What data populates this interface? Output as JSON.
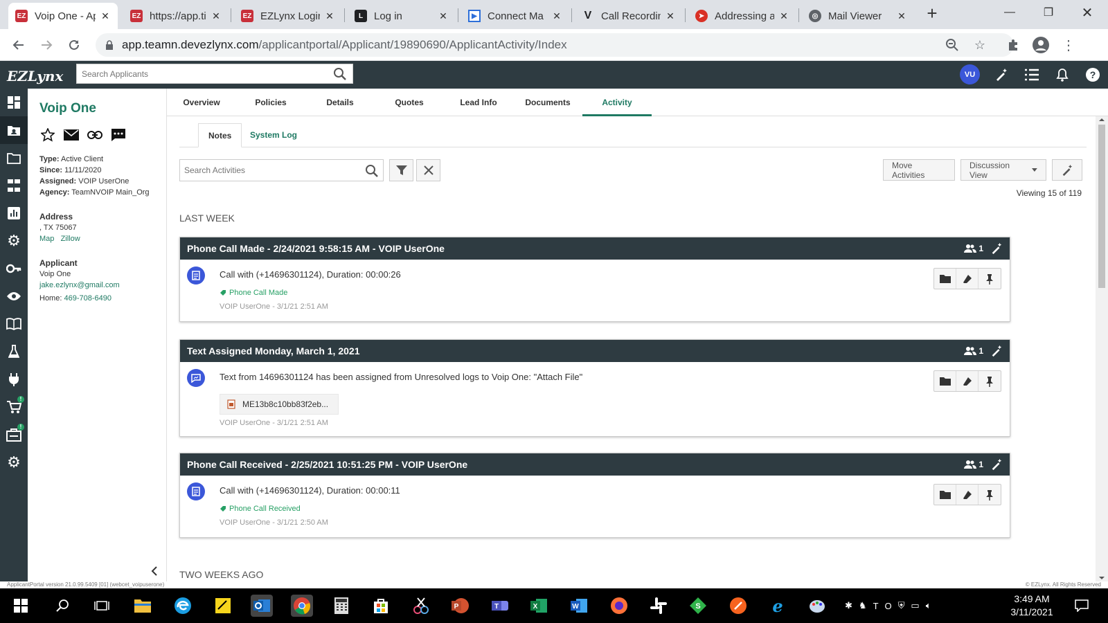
{
  "browser": {
    "tabs": [
      {
        "title": "Voip One - Ap",
        "favicon": "ezlynx-favicon",
        "color": "#c8303a"
      },
      {
        "title": "https://app.ti",
        "favicon": "ezlynx-favicon",
        "color": "#c8303a"
      },
      {
        "title": "EZLynx Login",
        "favicon": "ezlynx-favicon",
        "color": "#c8303a"
      },
      {
        "title": "Log in",
        "favicon": "l-favicon",
        "color": "#202124"
      },
      {
        "title": "Connect Ma",
        "favicon": "connect-favicon",
        "color": "#2d6fd9"
      },
      {
        "title": "Call Recordin",
        "favicon": "v-favicon",
        "color": "#202124"
      },
      {
        "title": "Addressing a",
        "favicon": "addressing-favicon",
        "color": "#d93025"
      },
      {
        "title": "Mail Viewer",
        "favicon": "globe-favicon",
        "color": "#5f6368"
      }
    ],
    "url_host": "app.teamn.devezlynx.com",
    "url_path": "/applicantportal/Applicant/19890690/ApplicantActivity/Index"
  },
  "header": {
    "logo": "EZLynx",
    "search_placeholder": "Search Applicants",
    "avatar_initials": "VU"
  },
  "leftnav": {
    "badge": "!"
  },
  "profile": {
    "name": "Voip One",
    "type_label": "Type:",
    "type_value": "Active Client",
    "since_label": "Since:",
    "since_value": "11/11/2020",
    "assigned_label": "Assigned:",
    "assigned_value": "VOIP UserOne",
    "agency_label": "Agency:",
    "agency_value": "TeamNVOIP Main_Org",
    "address_heading": "Address",
    "address_line": ", TX 75067",
    "map_link": "Map",
    "zillow_link": "Zillow",
    "applicant_heading": "Applicant",
    "applicant_name": "Voip One",
    "email": "jake.ezlynx@gmail.com",
    "home_label": "Home:",
    "home_phone": "469-708-6490"
  },
  "main_tabs": [
    "Overview",
    "Policies",
    "Details",
    "Quotes",
    "Lead Info",
    "Documents",
    "Activity"
  ],
  "sub_tabs": [
    "Notes",
    "System Log"
  ],
  "activity": {
    "search_placeholder": "Search Activities",
    "move_label": "Move Activities",
    "discussion_label": "Discussion View",
    "viewing": "Viewing 15 of 119",
    "section_last_week": "LAST WEEK",
    "section_two_weeks": "TWO WEEKS AGO",
    "cards": [
      {
        "title": "Phone Call Made - 2/24/2021 9:58:15 AM - VOIP UserOne",
        "count": "1",
        "text": "Call with (+14696301124), Duration: 00:00:26",
        "tag": "Phone Call Made",
        "meta": "VOIP UserOne - 3/1/21 2:51 AM"
      },
      {
        "title": "Text Assigned Monday, March 1, 2021",
        "count": "1",
        "text": "Text from 14696301124 has been assigned from Unresolved logs to Voip One: \"Attach File\"",
        "attachment": "ME13b8c10bb83f2eb...",
        "meta": "VOIP UserOne - 3/1/21 2:51 AM"
      },
      {
        "title": "Phone Call Received - 2/25/2021 10:51:25 PM - VOIP UserOne",
        "count": "1",
        "text": "Call with (+14696301124), Duration: 00:00:11",
        "tag": "Phone Call Received",
        "meta": "VOIP UserOne - 3/1/21 2:50 AM"
      }
    ]
  },
  "footer": {
    "version": "ApplicantPortal version 21.0.99.5409 [01] (webcet_voipuserone)",
    "copyright": "© EZLynx. All Rights Reserved"
  },
  "taskbar": {
    "time": "3:49 AM",
    "date": "3/11/2021"
  },
  "colors": {
    "brand_dark": "#2e3b41",
    "accent_green": "#1f7a63",
    "icon_blue": "#3b57d9"
  }
}
